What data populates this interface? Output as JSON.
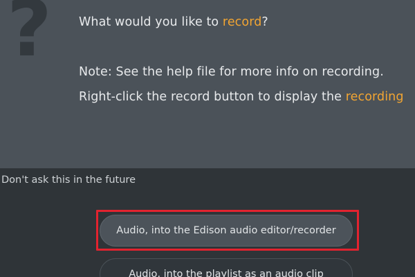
{
  "dialog": {
    "icon": "question-mark",
    "icon_glyph": "?",
    "prompt_prefix": "What would you like to ",
    "prompt_accent": "record",
    "prompt_suffix": "?",
    "note": "Note: See the help file for more info on recording.",
    "rightclick_prefix": "Right-click the record button to display the ",
    "rightclick_accent": "recording",
    "dont_ask": "Don't ask this in the future",
    "options": [
      {
        "label": "Audio, into the Edison audio editor/recorder"
      },
      {
        "label": "Audio, into the playlist as an audio clip"
      }
    ]
  },
  "colors": {
    "panel_bg": "#4b5259",
    "window_bg": "#2f3438",
    "accent": "#f2a532",
    "highlight_box": "#e3232f"
  }
}
